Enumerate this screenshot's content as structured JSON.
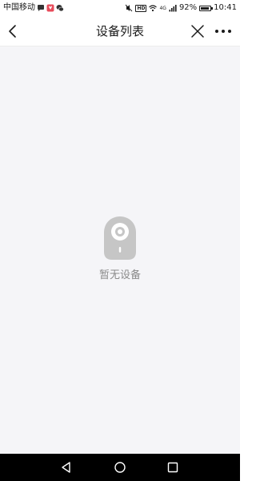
{
  "status_bar": {
    "carrier": "中国移动",
    "battery_percent": "92%",
    "battery_level": 0.92,
    "time": "10:41",
    "hd_label": "HD",
    "network_label": "4G",
    "icons": [
      "chat-bubble-icon",
      "app-badge-icon",
      "wechat-icon",
      "mute-icon",
      "wifi-icon",
      "signal-icon",
      "battery-icon"
    ]
  },
  "nav": {
    "title": "设备列表",
    "back_icon": "chevron-left-icon",
    "close_icon": "close-icon",
    "more_icon": "more-icon"
  },
  "empty_state": {
    "icon": "camera-device-icon",
    "text": "暂无设备"
  },
  "system_nav": {
    "icons": [
      "back-triangle-icon",
      "home-circle-icon",
      "recent-square-icon"
    ]
  },
  "colors": {
    "content_bg": "#f5f5f8",
    "icon_gray": "#c6c6c6",
    "text_gray": "#8a8a8a",
    "system_nav_bg": "#000000"
  }
}
